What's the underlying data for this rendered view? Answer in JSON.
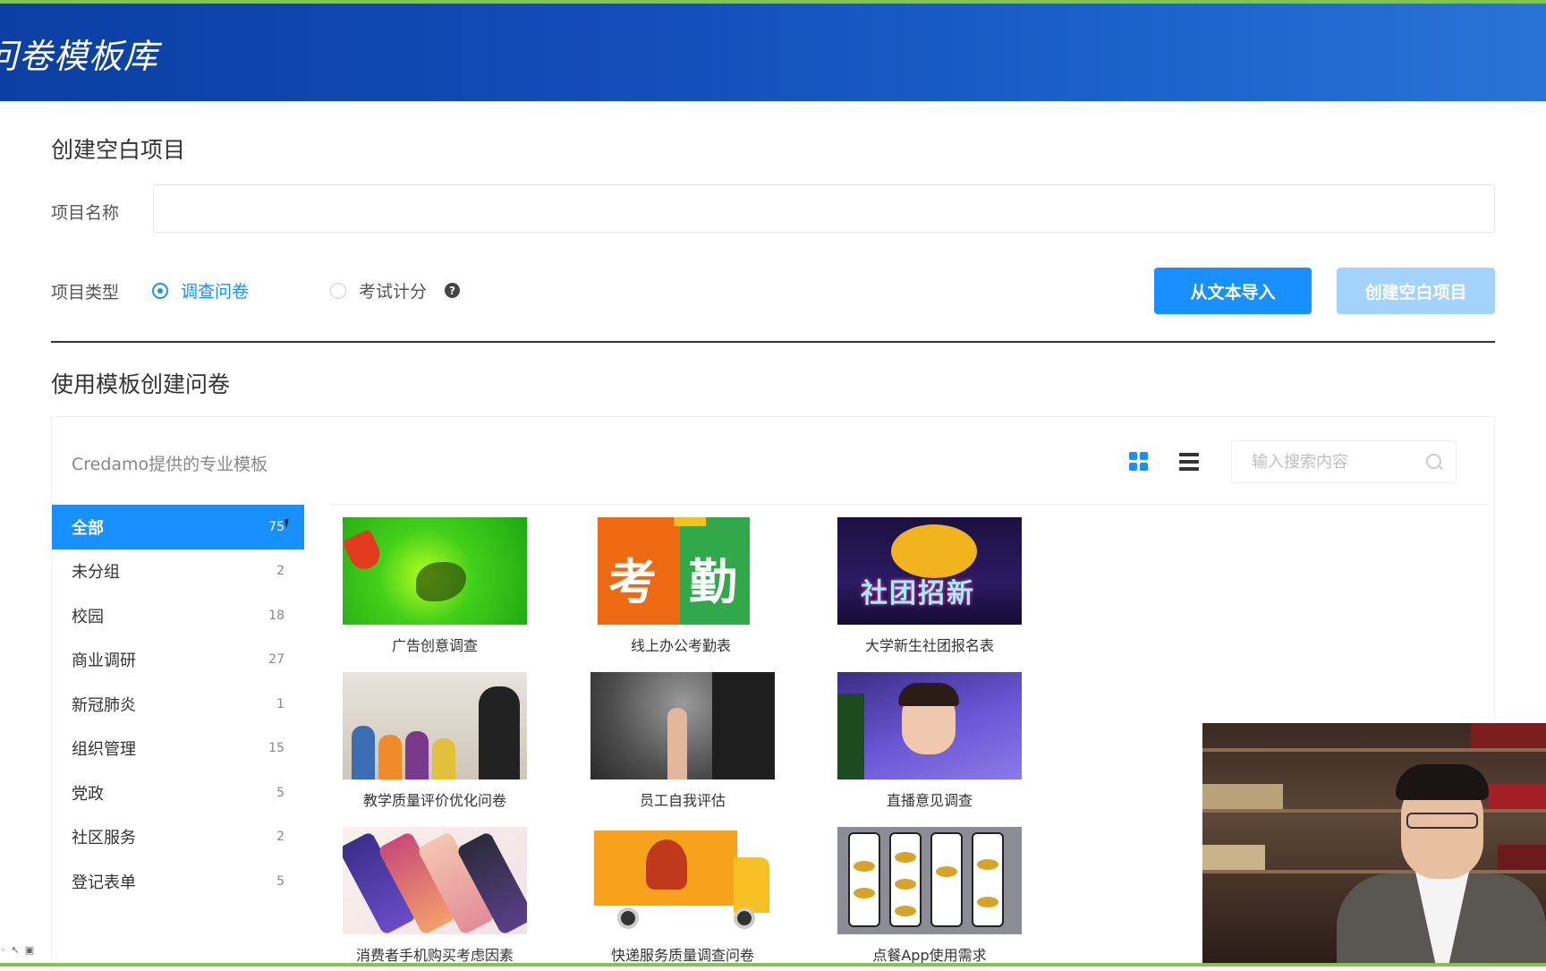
{
  "header": {
    "title": "问卷模板库"
  },
  "create_blank": {
    "section_title": "创建空白项目",
    "name_label": "项目名称",
    "name_value": "",
    "name_placeholder": "",
    "type_label": "项目类型",
    "type_options": [
      {
        "label": "调查问卷",
        "selected": true
      },
      {
        "label": "考试计分",
        "selected": false
      }
    ],
    "help_icon": "question-circle-icon",
    "import_button": "从文本导入",
    "create_button": "创建空白项目"
  },
  "templates": {
    "section_title": "使用模板创建问卷",
    "panel_title": "Credamo提供的专业模板",
    "view_icons": [
      "grid-view-icon",
      "list-view-icon"
    ],
    "search_placeholder": "输入搜索内容",
    "search_icon": "search-icon",
    "categories": [
      {
        "label": "全部",
        "count": "75"
      },
      {
        "label": "未分组",
        "count": "2"
      },
      {
        "label": "校园",
        "count": "18"
      },
      {
        "label": "商业调研",
        "count": "27"
      },
      {
        "label": "新冠肺炎",
        "count": "1"
      },
      {
        "label": "组织管理",
        "count": "15"
      },
      {
        "label": "党政",
        "count": "5"
      },
      {
        "label": "社区服务",
        "count": "2"
      },
      {
        "label": "登记表单",
        "count": "5"
      }
    ],
    "active_category": "全部",
    "cards": [
      {
        "title": "广告创意调查"
      },
      {
        "title": "线上办公考勤表",
        "thumb_text": [
          "考",
          "勤"
        ]
      },
      {
        "title": "大学新生社团报名表",
        "thumb_text": "社团招新"
      },
      {
        "title": "教学质量评价优化问卷"
      },
      {
        "title": "员工自我评估"
      },
      {
        "title": "直播意见调查"
      },
      {
        "title": "消费者手机购买考虑因素"
      },
      {
        "title": "快递服务质量调查问卷"
      },
      {
        "title": "点餐App使用需求"
      }
    ]
  },
  "colors": {
    "brand_blue": "#1890ff",
    "disabled_blue": "#a3d3fb",
    "header_gradient_start": "#0b3fa3",
    "header_gradient_end": "#2a73d6",
    "accent_green": "#7fc64a"
  }
}
